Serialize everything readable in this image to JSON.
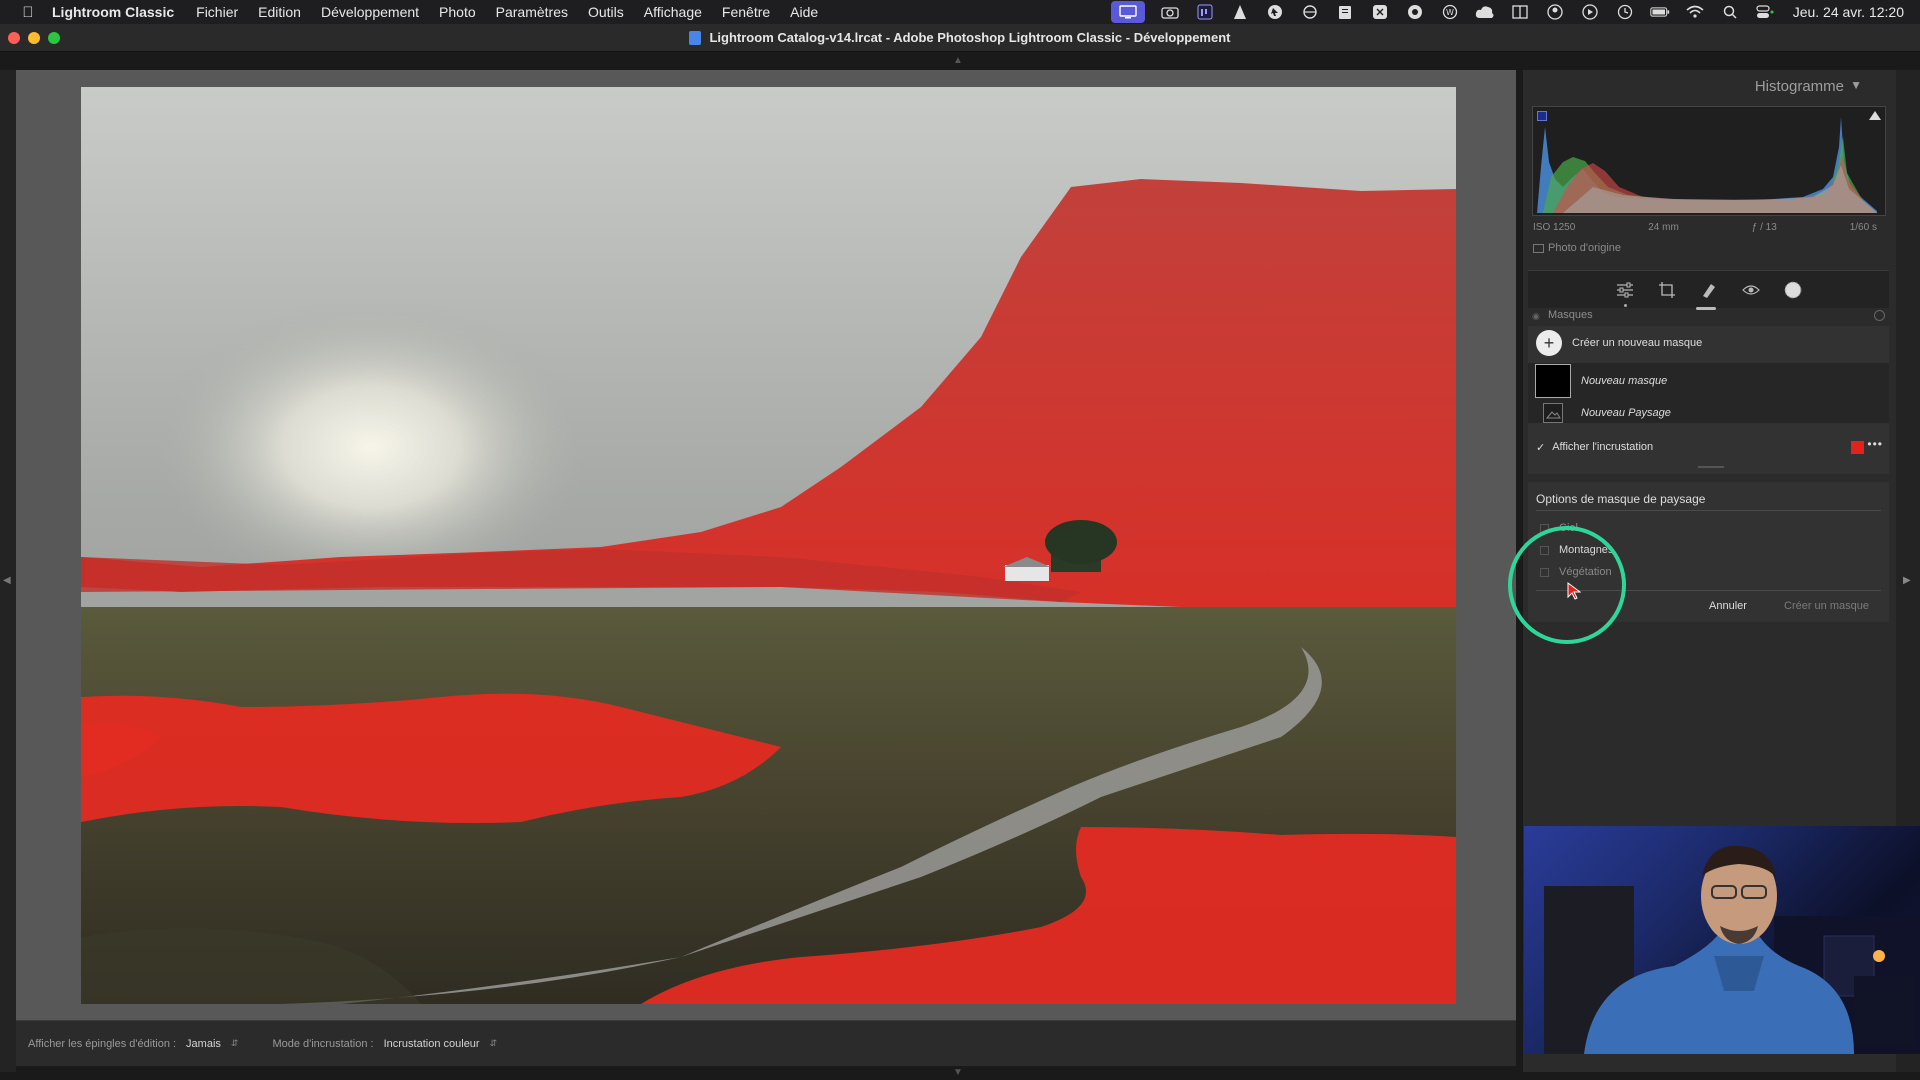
{
  "menubar": {
    "app_name": "Lightroom Classic",
    "items": [
      "Fichier",
      "Edition",
      "Développement",
      "Photo",
      "Paramètres",
      "Outils",
      "Affichage",
      "Fenêtre",
      "Aide"
    ],
    "clock": "Jeu. 24 avr.  12:20"
  },
  "window": {
    "title": "Lightroom Catalog-v14.lrcat - Adobe Photoshop Lightroom Classic - Développement"
  },
  "histogram": {
    "title": "Histogramme",
    "iso": "ISO 1250",
    "focal": "24 mm",
    "aperture": "ƒ / 13",
    "shutter": "1/60 s",
    "original_label": "Photo d'origine"
  },
  "masks": {
    "section_label": "Masques",
    "create_label": "Créer un nouveau masque",
    "mask_name": "Nouveau masque",
    "component_name": "Nouveau Paysage",
    "overlay_label": "Afficher l'incrustation",
    "overlay_color": "#e0231c"
  },
  "landscape_options": {
    "title": "Options de masque de paysage",
    "items": [
      "Ciel",
      "Montagnes",
      "Végétation"
    ],
    "cancel_label": "Annuler",
    "create_label": "Créer un masque"
  },
  "toolbar": {
    "pins_label": "Afficher les épingles d'édition :",
    "pins_value": "Jamais",
    "overlay_mode_label": "Mode d'incrustation :",
    "overlay_mode_value": "Incrustation couleur"
  },
  "colors": {
    "accent_ring": "#2fd69a",
    "mask_red": "#e0231c"
  }
}
